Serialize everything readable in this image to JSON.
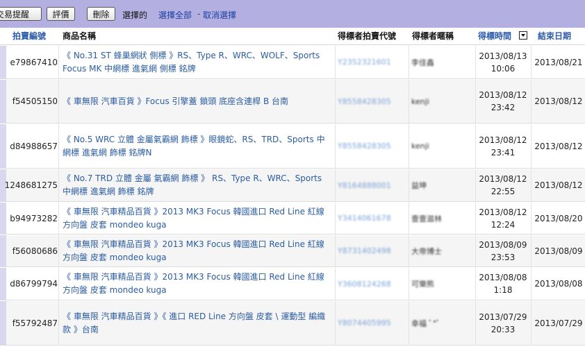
{
  "toolbar": {
    "buttons": [
      "交易提醒",
      "評價",
      "刪除"
    ],
    "selected_label": "選擇的",
    "select_all": "選擇全部",
    "separator": "-",
    "deselect": "取消選擇"
  },
  "table": {
    "columns": [
      "拍賣編號",
      "商品名稱",
      "得標者拍賣代號",
      "得標者暱稱",
      "得標時間",
      "結束日期"
    ],
    "rows": [
      {
        "id": "e79867410",
        "name": "《 No.31 ST 蜂巢網狀 側標 》RS、Type R、WRC、WOLF、Sports Focus MK 中網標 進氣網 側標 銘牌",
        "bidder_id": "Y2352321601",
        "nickname": "李佳鑫",
        "time_date": "2013/08/13",
        "time_clock": "10:06",
        "end": "2013/08/21"
      },
      {
        "id": "f54505150",
        "name": "《 車無限 汽車百貨 》Focus 引擎蓋 鎖頭 底座含連桿 B 台南",
        "bidder_id": "Y8558428305",
        "nickname": "kenji",
        "time_date": "2013/08/12",
        "time_clock": "23:42",
        "end": "2013/08/12"
      },
      {
        "id": "d84988657",
        "name": "《 No.5 WRC 立體 金屬氣霸網 飾標 》眼鏡蛇、RS、TRD、Sports 中網標 進氣網 飾標 銘牌N",
        "bidder_id": "Y8558428305",
        "nickname": "kenji",
        "time_date": "2013/08/12",
        "time_clock": "23:41",
        "end": "2013/08/12"
      },
      {
        "id": "1248681275",
        "name": "《 No.7 TRD 立體 金屬 氣霸網 飾標 》 RS、Type R、WRC、Sports 中網標 進氣網 飾標 銘牌",
        "bidder_id": "Y8164888001",
        "nickname": "益坤",
        "time_date": "2013/08/12",
        "time_clock": "22:55",
        "end": "2013/08/12"
      },
      {
        "id": "b94973282",
        "name": "《 車無限 汽車精品百貨 》2013 MK3 Focus 韓國進口 Red Line 紅線 方向盤 皮套 mondeo kuga",
        "bidder_id": "Y3414061678",
        "nickname": "壹壹滋林",
        "time_date": "2013/08/12",
        "time_clock": "12:24",
        "end": "2013/08/20"
      },
      {
        "id": "f56080686",
        "name": "《 車無限 汽車精品百貨 》2013 MK3 Focus 韓國進口 Red Line 紅線 方向盤 皮套 mondeo kuga",
        "bidder_id": "Y8731402498",
        "nickname": "大帝博士",
        "time_date": "2013/08/09",
        "time_clock": "23:53",
        "end": "2013/08/09"
      },
      {
        "id": "d86799794",
        "name": "《 車無限 汽車精品百貨 》2013 MK3 Focus 韓國進口 Red Line 紅線 方向盤 皮套 mondeo kuga",
        "bidder_id": "Y3608124268",
        "nickname": "可樂熊",
        "time_date": "2013/08/08",
        "time_clock": "1:18",
        "end": "2013/08/08"
      },
      {
        "id": "f55792487",
        "name": "《 車無限 汽車精品百貨 》《 進口 RED Line 方向盤 皮套 \\ 運動型 編織款 》台南",
        "bidder_id": "Y8074405995",
        "nickname": "幸福 ﾟ*ﾟ",
        "time_date": "2013/07/29",
        "time_clock": "20:33",
        "end": "2013/07/29"
      }
    ]
  },
  "colors": {
    "toolbar_bg": "#b3afe0",
    "header_link": "#2a5aa8",
    "product_link": "#2b5ca2",
    "row_alt_bg": "#f5f5f5"
  },
  "icons": {
    "sort": "sort-down-icon"
  }
}
